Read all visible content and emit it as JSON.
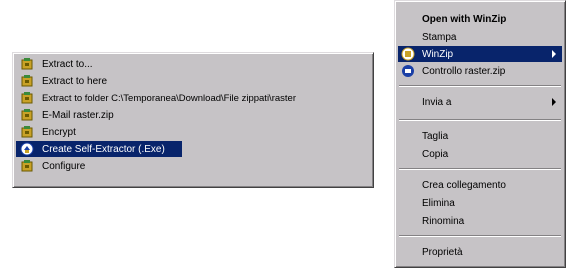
{
  "submenu": {
    "items": [
      {
        "label": "Extract to...",
        "icon": "winzip-vise-icon"
      },
      {
        "label": "Extract to here",
        "icon": "winzip-vise-icon"
      },
      {
        "label": "Extract to folder C:\\Temporanea\\Download\\File zippati\\raster",
        "icon": "winzip-vise-icon"
      },
      {
        "label": "E-Mail raster.zip",
        "icon": "winzip-vise-icon"
      },
      {
        "label": "Encrypt",
        "icon": "winzip-vise-icon"
      },
      {
        "label": "Create Self-Extractor (.Exe)",
        "icon": "winzip-self-extractor-icon",
        "selected": true
      },
      {
        "label": "Configure",
        "icon": "winzip-vise-icon"
      }
    ]
  },
  "context_menu": {
    "open_with": "Open with WinZip",
    "stampa": "Stampa",
    "winzip": "WinZip",
    "controllo": "Controllo raster.zip",
    "invia_a": "Invia a",
    "taglia": "Taglia",
    "copia": "Copia",
    "crea_collegamento": "Crea collegamento",
    "elimina": "Elimina",
    "rinomina": "Rinomina",
    "proprieta": "Proprietà"
  },
  "colors": {
    "menu_bg": "#c6c3c6",
    "highlight": "#08246b",
    "highlight_text": "#ffffff"
  }
}
